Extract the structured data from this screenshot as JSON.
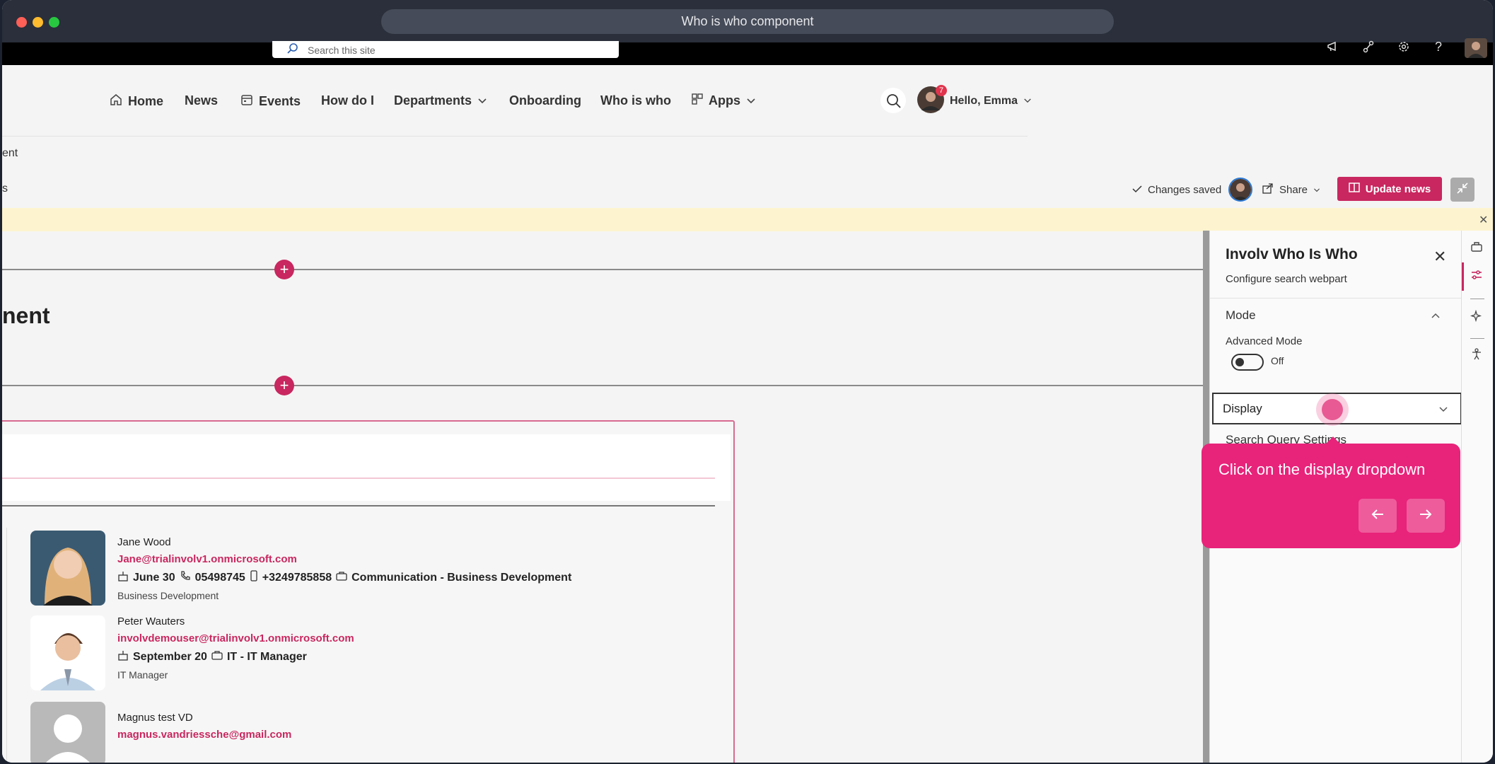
{
  "window": {
    "title": "Who is who component"
  },
  "suitebar": {
    "search_placeholder": "Search this site"
  },
  "nav": {
    "items": [
      "Home",
      "News",
      "Events",
      "How do I",
      "Departments",
      "Onboarding",
      "Who is who",
      "Apps"
    ],
    "greeting": "Hello, Emma",
    "notification_count": "7"
  },
  "subheader": {
    "partial1": "ent",
    "partial2": "s"
  },
  "commandbar": {
    "saved": "Changes saved",
    "share": "Share",
    "update": "Update news"
  },
  "canvas": {
    "title_partial": "nent"
  },
  "people": [
    {
      "name": "Jane Wood",
      "email": "Jane@trialinvolv1.onmicrosoft.com",
      "birthday": "June 30",
      "phone": "05498745",
      "mobile": "+3249785858",
      "job": "Communication - Business Development",
      "department": "Business Development"
    },
    {
      "name": "Peter Wauters",
      "email": "involvdemouser@trialinvolv1.onmicrosoft.com",
      "birthday": "September 20",
      "job": "IT - IT Manager",
      "department": "IT Manager"
    },
    {
      "name": "Magnus test VD",
      "email": "magnus.vandriessche@gmail.com"
    }
  ],
  "panel": {
    "title": "Involv Who Is Who",
    "subtitle": "Configure search webpart",
    "mode_label": "Mode",
    "advanced_label": "Advanced Mode",
    "advanced_value": "Off",
    "display_label": "Display",
    "search_query_label": "Search Query Settings"
  },
  "tooltip": {
    "text": "Click on the display dropdown"
  },
  "colors": {
    "accent": "#c8275f",
    "tooltip": "#e8237a",
    "banner": "#fdf4cf"
  }
}
